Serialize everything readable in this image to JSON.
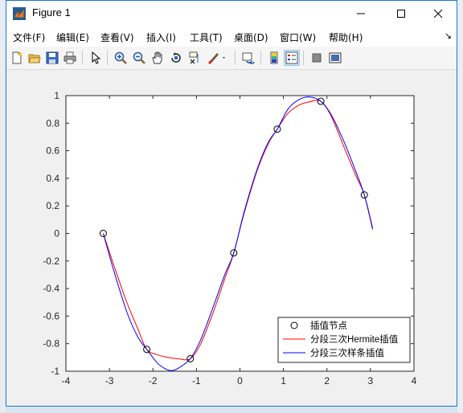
{
  "window": {
    "title": "Figure 1",
    "controls": {
      "minimize": "—",
      "maximize": "☐",
      "close": "✕"
    }
  },
  "menu": {
    "items": [
      "文件(F)",
      "编辑(E)",
      "查看(V)",
      "插入(I)",
      "工具(T)",
      "桌面(D)",
      "窗口(W)",
      "帮助(H)"
    ],
    "overflow": "↘"
  },
  "toolbar": {
    "icons": [
      "new-figure-icon",
      "open-folder-icon",
      "save-icon",
      "print-icon",
      "pointer-icon",
      "zoom-in-icon",
      "zoom-out-icon",
      "pan-hand-icon",
      "rotate-3d-icon",
      "data-cursor-icon",
      "brush-icon",
      "link-plot-icon",
      "colorbar-icon",
      "legend-icon",
      "hide-tools-icon",
      "show-tools-icon"
    ]
  },
  "colors": {
    "accent": "#1979ca",
    "hermite": "#ff0000",
    "spline": "#0000ff",
    "nodes": "#000000"
  },
  "chart_data": {
    "type": "line",
    "xlim": [
      -4,
      4
    ],
    "ylim": [
      -1,
      1
    ],
    "xticks": [
      "-4",
      "-3",
      "-2",
      "-1",
      "0",
      "1",
      "2",
      "3",
      "4"
    ],
    "yticks": [
      "1",
      "0.8",
      "0.6",
      "0.4",
      "0.2",
      "0",
      "-0.2",
      "-0.4",
      "-0.6",
      "-0.8",
      "-1"
    ],
    "grid": false,
    "legend_position": "bottom-right",
    "series": [
      {
        "name": "插值节点",
        "style": "markers",
        "x": [
          -3.1416,
          -2.1416,
          -1.1416,
          -0.1416,
          0.8584,
          1.8584,
          2.8584
        ],
        "y": [
          0.0,
          -0.8415,
          -0.9093,
          -0.1411,
          0.7568,
          0.9589,
          0.2794
        ]
      },
      {
        "name": "分段三次Hermite插值",
        "style": "line",
        "x": [
          -3.1416,
          -2.9,
          -2.6,
          -2.35,
          -2.1416,
          -1.9,
          -1.65,
          -1.4,
          -1.1416,
          -0.9,
          -0.6,
          -0.35,
          -0.1416,
          0.1,
          0.4,
          0.65,
          0.8584,
          1.1,
          1.35,
          1.6,
          1.8584,
          2.1,
          2.4,
          2.65,
          2.8584,
          3.05
        ],
        "y": [
          0.0,
          -0.23,
          -0.5,
          -0.69,
          -0.8415,
          -0.88,
          -0.9,
          -0.91,
          -0.9093,
          -0.8,
          -0.56,
          -0.33,
          -0.1411,
          0.15,
          0.46,
          0.65,
          0.7568,
          0.87,
          0.93,
          0.955,
          0.9589,
          0.85,
          0.62,
          0.43,
          0.2794,
          0.04
        ]
      },
      {
        "name": "分段三次样条插值",
        "style": "line",
        "x": [
          -3.1416,
          -2.9,
          -2.6,
          -2.35,
          -2.1416,
          -1.9,
          -1.7,
          -1.55,
          -1.4,
          -1.1416,
          -0.9,
          -0.6,
          -0.35,
          -0.1416,
          0.1,
          0.4,
          0.65,
          0.8584,
          1.1,
          1.35,
          1.6,
          1.8584,
          2.1,
          2.4,
          2.65,
          2.8584,
          3.05
        ],
        "y": [
          0.0,
          -0.27,
          -0.57,
          -0.75,
          -0.8415,
          -0.94,
          -0.985,
          -0.995,
          -0.975,
          -0.9093,
          -0.77,
          -0.52,
          -0.3,
          -0.1411,
          0.16,
          0.47,
          0.66,
          0.7568,
          0.9,
          0.97,
          0.99,
          0.9589,
          0.86,
          0.66,
          0.46,
          0.2794,
          0.03
        ]
      }
    ]
  }
}
